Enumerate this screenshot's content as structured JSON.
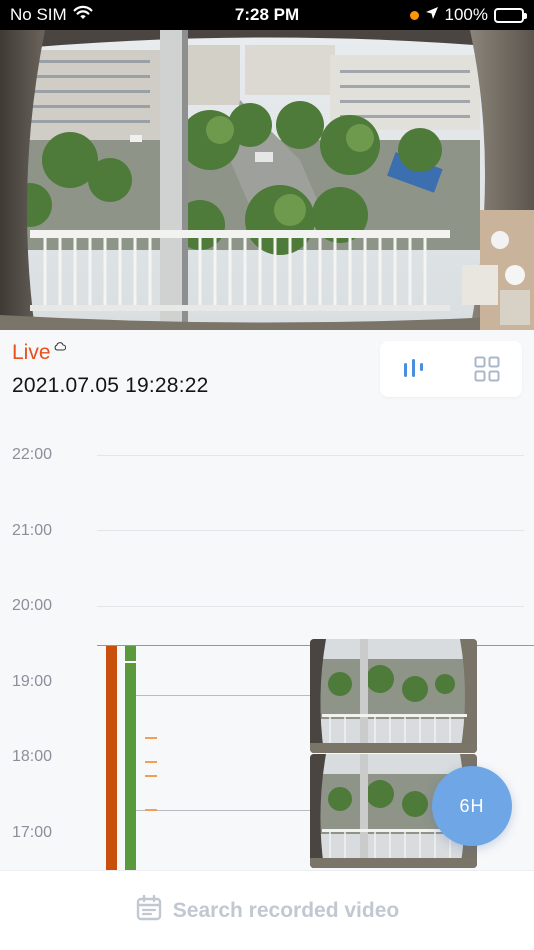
{
  "status_bar": {
    "carrier": "No SIM",
    "time": "7:28 PM",
    "battery": "100%",
    "icons": [
      "wifi-icon",
      "location-arrow-icon",
      "battery-icon"
    ]
  },
  "camera": {
    "description_icon": "live-camera-feed"
  },
  "live": {
    "label": "Live",
    "timestamp": "2021.07.05 19:28:22",
    "cloud_icon": "cloud-icon"
  },
  "view_toggle": {
    "icons": [
      "timeline-view-icon",
      "grid-view-icon"
    ]
  },
  "timeline": {
    "hours": [
      "22:00",
      "21:00",
      "20:00",
      "19:00",
      "18:00",
      "17:00"
    ],
    "colors": {
      "recording_orange": "#c8500c",
      "recording_green": "#5a9a3c",
      "event_tick": "#f0a050",
      "now_line": "#6ea0d6"
    }
  },
  "fab": {
    "label": "6H"
  },
  "bottom": {
    "label": "Search recorded video",
    "icon": "calendar-icon"
  },
  "colors": {
    "accent": "#e8501c",
    "fab": "#6fa6e6",
    "disabled_text": "#c2c8d2"
  }
}
